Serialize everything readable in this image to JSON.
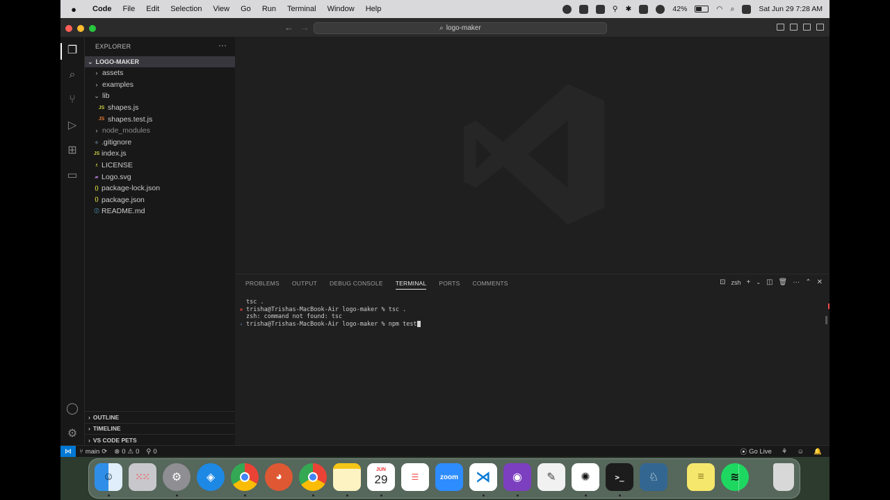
{
  "menubar": {
    "app": "Code",
    "items": [
      "File",
      "Edit",
      "Selection",
      "View",
      "Go",
      "Run",
      "Terminal",
      "Window",
      "Help"
    ],
    "battery": "42%",
    "datetime": "Sat Jun 29  7:28 AM"
  },
  "titlebar": {
    "search": "logo-maker",
    "back_icon": "arrow-left-icon",
    "forward_icon": "arrow-right-icon"
  },
  "explorer": {
    "title": "EXPLORER",
    "more": "···",
    "folder": "LOGO-MAKER",
    "items": [
      {
        "label": "assets",
        "type": "folder"
      },
      {
        "label": "examples",
        "type": "folder"
      },
      {
        "label": "lib",
        "type": "folder-open"
      },
      {
        "label": "shapes.js",
        "type": "js"
      },
      {
        "label": "shapes.test.js",
        "type": "test-js"
      },
      {
        "label": "node_modules",
        "type": "folder"
      },
      {
        "label": ".gitignore",
        "type": "git"
      },
      {
        "label": "index.js",
        "type": "js"
      },
      {
        "label": "LICENSE",
        "type": "license"
      },
      {
        "label": "Logo.svg",
        "type": "svg"
      },
      {
        "label": "package-lock.json",
        "type": "json"
      },
      {
        "label": "package.json",
        "type": "json"
      },
      {
        "label": "README.md",
        "type": "md"
      }
    ],
    "bottom_sections": [
      "OUTLINE",
      "TIMELINE",
      "VS CODE PETS"
    ]
  },
  "panel": {
    "tabs": [
      "PROBLEMS",
      "OUTPUT",
      "DEBUG CONSOLE",
      "TERMINAL",
      "PORTS",
      "COMMENTS"
    ],
    "active_tab": "TERMINAL",
    "shell": "zsh",
    "lines": [
      {
        "gutter": "",
        "text": "tsc ."
      },
      {
        "gutter": "⊗",
        "text": "trisha@Trishas-MacBook-Air logo-maker % tsc ."
      },
      {
        "gutter": "",
        "text": "zsh: command not found: tsc"
      },
      {
        "gutter": "✧",
        "text": "trisha@Trishas-MacBook-Air logo-maker % npm test"
      }
    ]
  },
  "statusbar": {
    "branch": "main",
    "errors": "0",
    "warnings": "0",
    "ports": "0",
    "go_live": "Go Live"
  },
  "dock": {
    "apps": [
      {
        "name": "finder",
        "label": "",
        "color": "#2f8fe8"
      },
      {
        "name": "launchpad",
        "label": "",
        "color": "#c7c7cc"
      },
      {
        "name": "system-settings",
        "label": "",
        "color": "#8e8e93"
      },
      {
        "name": "safari",
        "label": "",
        "color": "#1e88e5"
      },
      {
        "name": "chrome",
        "label": "",
        "color": "#f4f4f4"
      },
      {
        "name": "duckduckgo",
        "label": "",
        "color": "#de5833"
      },
      {
        "name": "chrome-dev",
        "label": "",
        "color": "#f4f4f4"
      },
      {
        "name": "notes",
        "label": "",
        "color": "#fdf3c2"
      },
      {
        "name": "calendar",
        "label": "29",
        "month": "JUN",
        "color": "#ffffff"
      },
      {
        "name": "reminders",
        "label": "",
        "color": "#ffffff"
      },
      {
        "name": "zoom",
        "label": "zoom",
        "color": "#2d8cff"
      },
      {
        "name": "vscode",
        "label": "",
        "color": "#ffffff"
      },
      {
        "name": "github-desktop",
        "label": "",
        "color": "#7b3fbf"
      },
      {
        "name": "textedit",
        "label": "",
        "color": "#f1f1f1"
      },
      {
        "name": "chatgpt",
        "label": "",
        "color": "#ffffff"
      },
      {
        "name": "terminal",
        "label": ">_",
        "color": "#1c1c1c"
      },
      {
        "name": "postgres",
        "label": "",
        "color": "#336791"
      },
      {
        "name": "stickies",
        "label": "",
        "color": "#f5e76b"
      },
      {
        "name": "spotify",
        "label": "",
        "color": "#1ed760"
      },
      {
        "name": "trash",
        "label": "",
        "color": "#d8d8d8"
      }
    ]
  }
}
